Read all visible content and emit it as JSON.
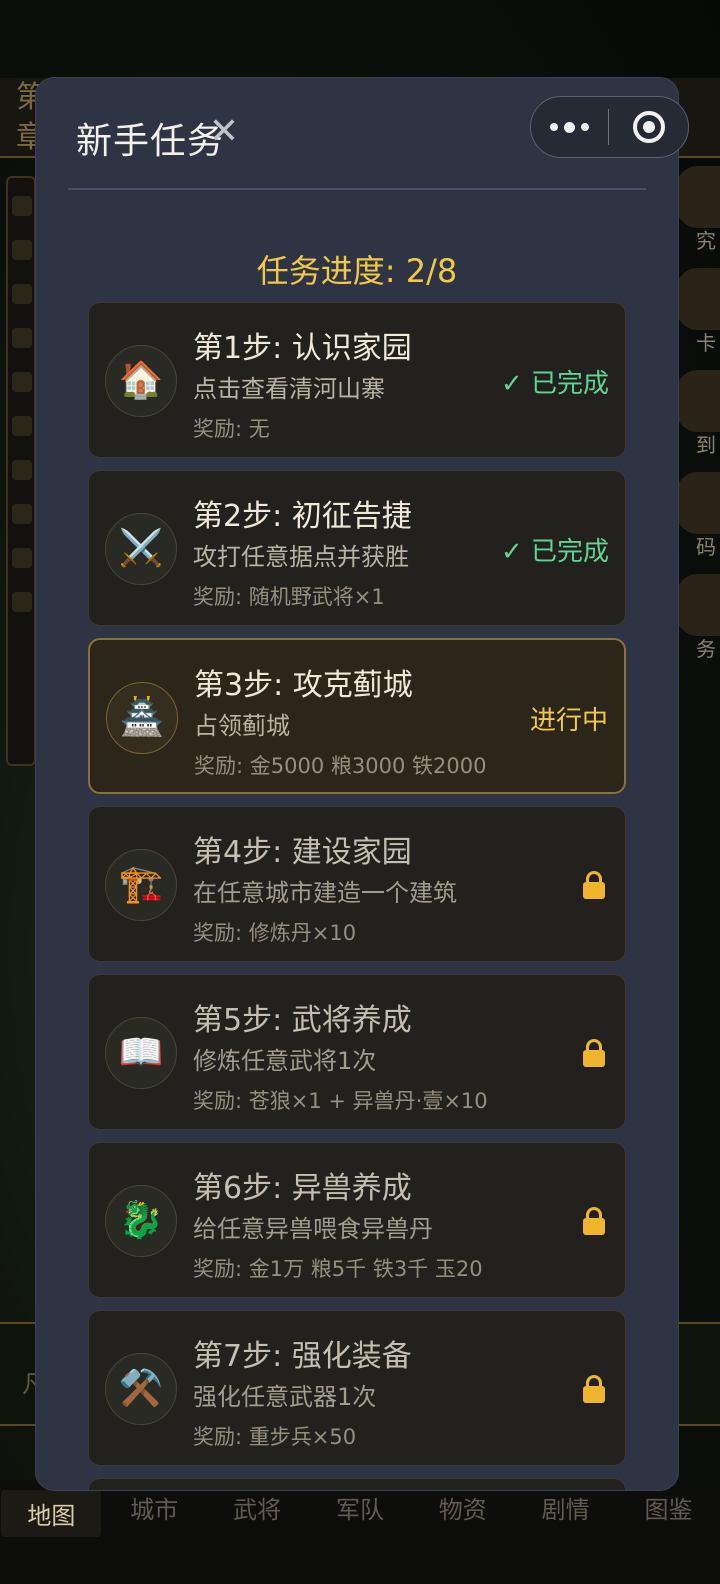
{
  "background": {
    "top_peek": "第\n章",
    "right_labels": [
      "究",
      "卡",
      "到",
      "码",
      "务"
    ],
    "bottom_peek": "凡",
    "nav": [
      "地图",
      "城市",
      "武将",
      "军队",
      "物资",
      "剧情",
      "图鉴"
    ]
  },
  "modal": {
    "title": "新手任务",
    "close_glyph": "✕",
    "progress": "任务进度: 2/8"
  },
  "tasks": [
    {
      "icon": "🏠",
      "icon_name": "house-icon",
      "title": "第1步: 认识家园",
      "desc": "点击查看清河山寨",
      "reward": "奖励: 无",
      "status": "done",
      "status_text": "✓ 已完成"
    },
    {
      "icon": "⚔️",
      "icon_name": "crossed-swords-icon",
      "title": "第2步: 初征告捷",
      "desc": "攻打任意据点并获胜",
      "reward": "奖励: 随机野武将×1",
      "status": "done",
      "status_text": "✓ 已完成"
    },
    {
      "icon": "🏯",
      "icon_name": "castle-icon",
      "title": "第3步: 攻克蓟城",
      "desc": "占领蓟城",
      "reward": "奖励: 金5000 粮3000 铁2000",
      "status": "active",
      "status_text": "进行中"
    },
    {
      "icon": "🏗️",
      "icon_name": "construction-crane-icon",
      "title": "第4步: 建设家园",
      "desc": "在任意城市建造一个建筑",
      "reward": "奖励: 修炼丹×10",
      "status": "locked",
      "status_text": ""
    },
    {
      "icon": "📖",
      "icon_name": "open-book-icon",
      "title": "第5步: 武将养成",
      "desc": "修炼任意武将1次",
      "reward": "奖励: 苍狼×1 + 异兽丹·壹×10",
      "status": "locked",
      "status_text": ""
    },
    {
      "icon": "🐉",
      "icon_name": "dragon-icon",
      "title": "第6步: 异兽养成",
      "desc": "给任意异兽喂食异兽丹",
      "reward": "奖励: 金1万 粮5千 铁3千 玉20",
      "status": "locked",
      "status_text": ""
    },
    {
      "icon": "⚒️",
      "icon_name": "hammer-pick-icon",
      "title": "第7步: 强化装备",
      "desc": "强化任意武器1次",
      "reward": "奖励: 重步兵×50",
      "status": "locked",
      "status_text": ""
    }
  ],
  "colors": {
    "accent_gold": "#f1c94a",
    "done_green": "#5fd494",
    "lock_orange": "#f1b530",
    "modal_bg": "#2e3444"
  }
}
